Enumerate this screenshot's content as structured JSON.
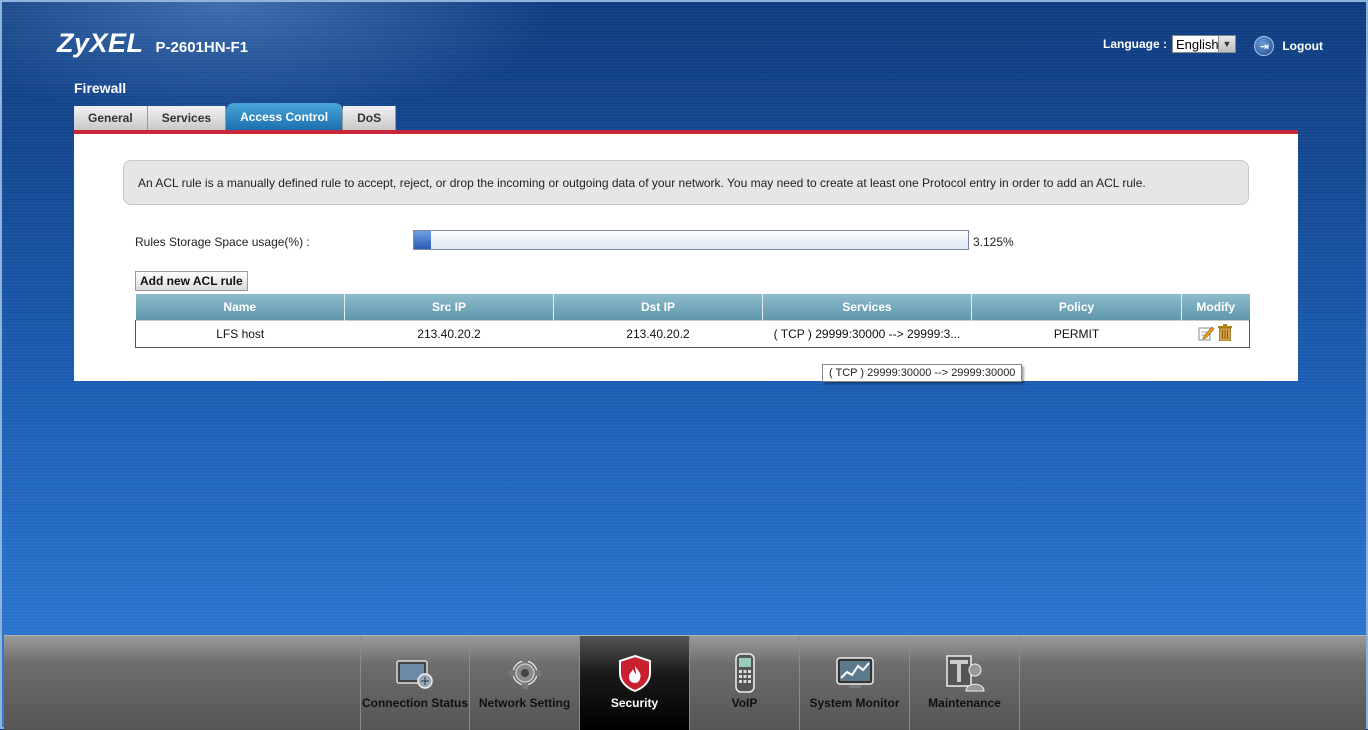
{
  "header": {
    "logo": "ZyXEL",
    "model": "P-2601HN-F1",
    "language_label": "Language :",
    "language_value": "English",
    "logout_label": "Logout"
  },
  "page_title": "Firewall",
  "tabs": [
    {
      "label": "General",
      "active": false
    },
    {
      "label": "Services",
      "active": false
    },
    {
      "label": "Access Control",
      "active": true
    },
    {
      "label": "DoS",
      "active": false
    }
  ],
  "info_text": "An ACL rule is a manually defined rule to accept, reject, or drop the incoming or outgoing data of your network. You may need to create at least one Protocol entry in order to add an ACL rule.",
  "storage": {
    "label": "Rules Storage Space usage(%) :",
    "value": "3.125%",
    "fraction": 0.03125
  },
  "add_button": "Add new ACL rule",
  "table": {
    "headers": [
      "Name",
      "Src IP",
      "Dst IP",
      "Services",
      "Policy",
      "Modify"
    ],
    "rows": [
      {
        "name": "LFS host",
        "src_ip": "213.40.20.2",
        "dst_ip": "213.40.20.2",
        "services": "( TCP ) 29999:30000 --> 29999:3...",
        "policy": "PERMIT"
      }
    ]
  },
  "tooltip": "( TCP ) 29999:30000 --> 29999:30000",
  "nav": [
    {
      "label": "Connection Status",
      "icon": "connection-status-icon",
      "active": false
    },
    {
      "label": "Network Setting",
      "icon": "gear-icon",
      "active": false
    },
    {
      "label": "Security",
      "icon": "firewall-shield-icon",
      "active": true
    },
    {
      "label": "VoIP",
      "icon": "phone-icon",
      "active": false
    },
    {
      "label": "System Monitor",
      "icon": "monitor-chart-icon",
      "active": false
    },
    {
      "label": "Maintenance",
      "icon": "maintenance-icon",
      "active": false
    }
  ],
  "colors": {
    "accent_red": "#c8263a",
    "tab_active": "#1c6fb0",
    "table_header": "#5e97ac"
  }
}
